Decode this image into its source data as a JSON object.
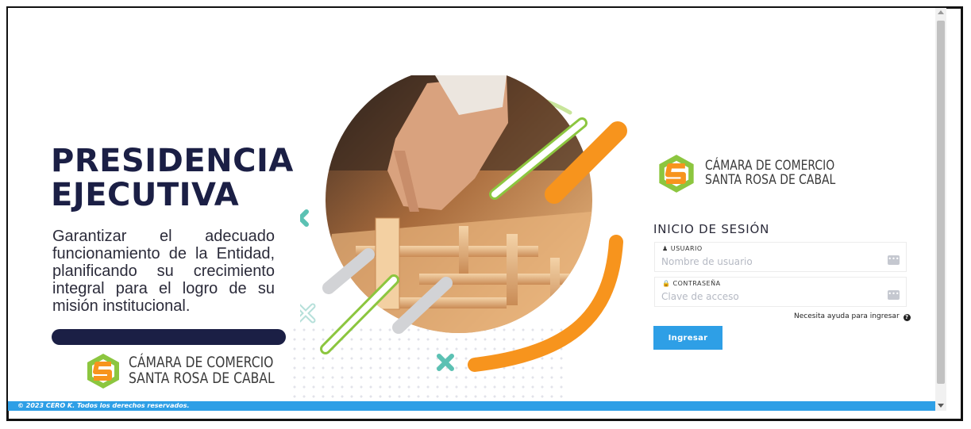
{
  "hero": {
    "title_line1": "PRESIDENCIA",
    "title_line2": "EJECUTIVA",
    "description": "Garantizar el adecuado funcionamiento de la Entidad, planificando su crecimiento integral para el logro de su misión institucional."
  },
  "logo": {
    "line1": "CÁMARA DE COMERCIO",
    "line2": "SANTA ROSA DE CABAL"
  },
  "login": {
    "title": "INICIO DE SESIÓN",
    "username": {
      "icon": "user-icon",
      "label": "USUARIO",
      "placeholder": "Nombre de usuario",
      "value": ""
    },
    "password": {
      "icon": "lock-icon",
      "label": "CONTRASEÑA",
      "placeholder": "Clave de acceso",
      "value": ""
    },
    "help_text": "Necesita ayuda para ingresar",
    "help_icon": "question-circle-icon",
    "submit_label": "Ingresar"
  },
  "footer": {
    "text": "© 2023 CERO K. Todos los derechos reservados."
  },
  "colors": {
    "navy": "#1b1f45",
    "accent_blue": "#2e9fe6",
    "orange": "#f7941d",
    "green": "#8cc63f",
    "teal": "#5bc1b3"
  }
}
